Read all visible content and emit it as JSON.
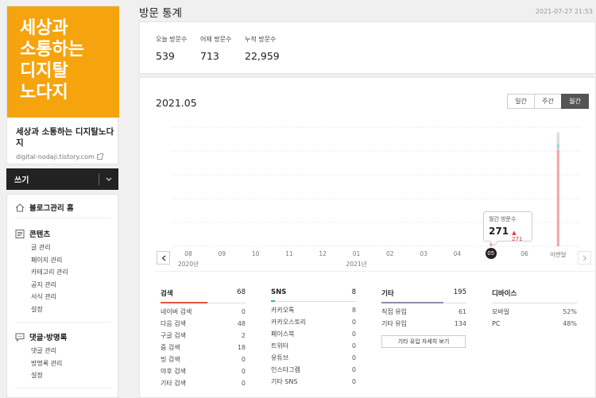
{
  "sidebar": {
    "logo_lines": [
      "세상과",
      "소통하는",
      "디지탈",
      "노다지"
    ],
    "blog_name": "세상과 소통하는 디지탈노다지",
    "blog_url": "digital-nodaji.tistory.com",
    "write_label": "쓰기",
    "menu": {
      "home": "블로그관리 홈",
      "contents": {
        "title": "콘텐츠",
        "items": [
          "글 관리",
          "페이지 관리",
          "카테고리 관리",
          "공지 관리",
          "서식 관리",
          "설정"
        ]
      },
      "comments": {
        "title": "댓글·방명록",
        "items": [
          "댓글 관리",
          "방명록 관리",
          "설정"
        ]
      }
    }
  },
  "header": {
    "title": "방문 통계",
    "timestamp": "2021-07-27 21:53"
  },
  "summary": [
    {
      "label": "오늘 방문수",
      "value": "539"
    },
    {
      "label": "어제 방문수",
      "value": "713"
    },
    {
      "label": "누적 방문수",
      "value": "22,959"
    }
  ],
  "chart_panel": {
    "period": "2021.05",
    "tabs": [
      "일간",
      "주간",
      "월간"
    ],
    "active_tab": "월간",
    "tooltip": {
      "label": "월간 방문수",
      "value": "271",
      "change": "271"
    }
  },
  "chart_data": {
    "type": "bar",
    "categories": [
      "08",
      "09",
      "10",
      "11",
      "12",
      "01",
      "02",
      "03",
      "04",
      "05",
      "06",
      "이번달"
    ],
    "year_labels": [
      {
        "index": 0,
        "text": "2020년"
      },
      {
        "index": 5,
        "text": "2021년"
      }
    ],
    "values": [
      0,
      0,
      0,
      0,
      0,
      0,
      0,
      0,
      0,
      271,
      0,
      10500
    ],
    "selected_index": 9,
    "ylim": [
      0,
      11000
    ],
    "grid": true,
    "colors": {
      "bar": "#f4a3a0",
      "bar_top": "#9fd8d6",
      "bar_inactive": "#dddddd"
    }
  },
  "categories": [
    {
      "title": "검색",
      "total": "68",
      "accent": "#e5533d",
      "accent_fraction": 0.55,
      "rows": [
        {
          "label": "네이버 검색",
          "value": "0"
        },
        {
          "label": "다음 검색",
          "value": "48"
        },
        {
          "label": "구글 검색",
          "value": "2"
        },
        {
          "label": "줌 검색",
          "value": "18"
        },
        {
          "label": "빙 검색",
          "value": "0"
        },
        {
          "label": "야후 검색",
          "value": "0"
        },
        {
          "label": "기타 검색",
          "value": "0"
        }
      ]
    },
    {
      "title": "SNS",
      "total": "8",
      "accent": "#2bb5a6",
      "accent_fraction": 0.05,
      "rows": [
        {
          "label": "카카오톡",
          "value": "8"
        },
        {
          "label": "카카오스토리",
          "value": "0"
        },
        {
          "label": "페이스북",
          "value": "0"
        },
        {
          "label": "트위터",
          "value": "0"
        },
        {
          "label": "유튜브",
          "value": "0"
        },
        {
          "label": "인스타그램",
          "value": "0"
        },
        {
          "label": "기타 SNS",
          "value": "0"
        }
      ]
    },
    {
      "title": "기타",
      "total": "195",
      "accent": "#8c8fa8",
      "accent_fraction": 0.73,
      "rows": [
        {
          "label": "직접 유입",
          "value": "61"
        },
        {
          "label": "기타 유입",
          "value": "134"
        }
      ],
      "button": "기타 유입 자세히 보기"
    },
    {
      "title": "디바이스",
      "total": "",
      "accent": "#222222",
      "accent_fraction": 0,
      "rows": [
        {
          "label": "모바일",
          "value": "52%"
        },
        {
          "label": "PC",
          "value": "48%"
        }
      ]
    }
  ]
}
